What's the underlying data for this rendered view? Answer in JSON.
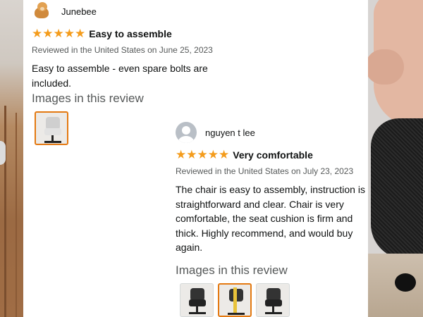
{
  "reviews": [
    {
      "author": "Junebee",
      "avatar_icon": "dog-avatar-icon",
      "rating": 5,
      "title": "Easy to assemble",
      "meta": "Reviewed in the United States on June 25, 2023",
      "body": "Easy to assemble - even spare bolts are included.",
      "images_header": "Images in this review",
      "image_count": 1
    },
    {
      "author": "nguyen t lee",
      "avatar_icon": "default-user-avatar-icon",
      "rating": 5,
      "title": "Very comfortable",
      "meta": "Reviewed in the United States on July 23, 2023",
      "body": "The chair is easy to assembly, instruction is straightforward and clear. Chair is very comfortable, the seat cushion is firm and thick. Highly recommend, and would buy again.",
      "images_header": "Images in this review",
      "image_count": 3
    }
  ],
  "colors": {
    "star": "#f49c1c",
    "meta_text": "#565959",
    "selected_border": "#e47911"
  }
}
